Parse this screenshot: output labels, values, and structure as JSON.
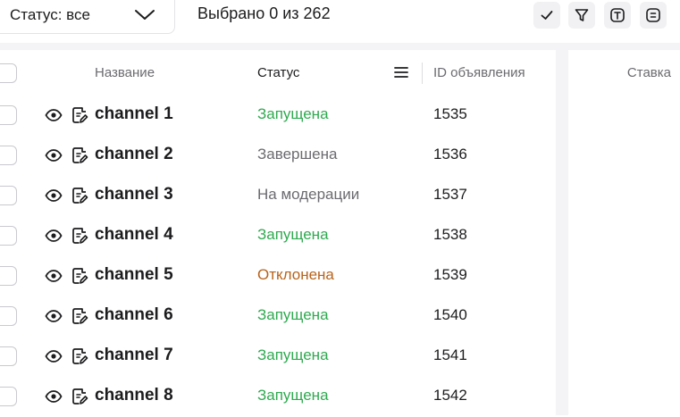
{
  "toolbar": {
    "status_filter": "Статус: все",
    "selected_text": "Выбрано 0 из 262",
    "colors": {
      "button_bg": "#f1f1f3"
    }
  },
  "table": {
    "headers": {
      "name": "Название",
      "status": "Статус",
      "id": "ID объявления"
    },
    "rows": [
      {
        "name": "channel 1",
        "status": "Запущена",
        "status_color": "#2eaa4f",
        "id": "1535"
      },
      {
        "name": "channel 2",
        "status": "Завершена",
        "status_color": "#6b6b70",
        "id": "1536"
      },
      {
        "name": "channel 3",
        "status": "На модерации",
        "status_color": "#6b6b70",
        "id": "1537"
      },
      {
        "name": "channel 4",
        "status": "Запущена",
        "status_color": "#2eaa4f",
        "id": "1538"
      },
      {
        "name": "channel 5",
        "status": "Отклонена",
        "status_color": "#b8621b",
        "id": "1539"
      },
      {
        "name": "channel 6",
        "status": "Запущена",
        "status_color": "#2eaa4f",
        "id": "1540"
      },
      {
        "name": "channel 7",
        "status": "Запущена",
        "status_color": "#2eaa4f",
        "id": "1541"
      },
      {
        "name": "channel 8",
        "status": "Запущена",
        "status_color": "#2eaa4f",
        "id": "1542"
      }
    ]
  },
  "right_panel": {
    "header": "Ставка"
  }
}
